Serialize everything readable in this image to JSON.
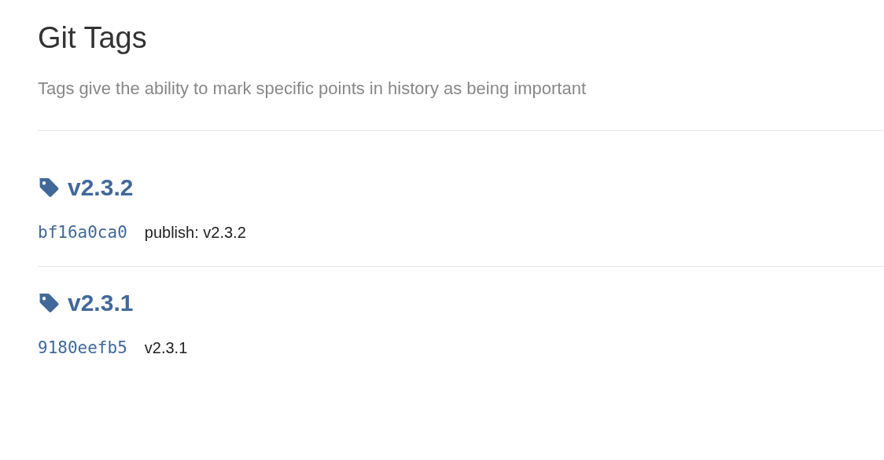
{
  "title": "Git Tags",
  "subtitle": "Tags give the ability to mark specific points in history as being important",
  "tags": [
    {
      "name": "v2.3.2",
      "commit": "bf16a0ca0",
      "message": "publish: v2.3.2"
    },
    {
      "name": "v2.3.1",
      "commit": "9180eefb5",
      "message": "v2.3.1"
    }
  ]
}
